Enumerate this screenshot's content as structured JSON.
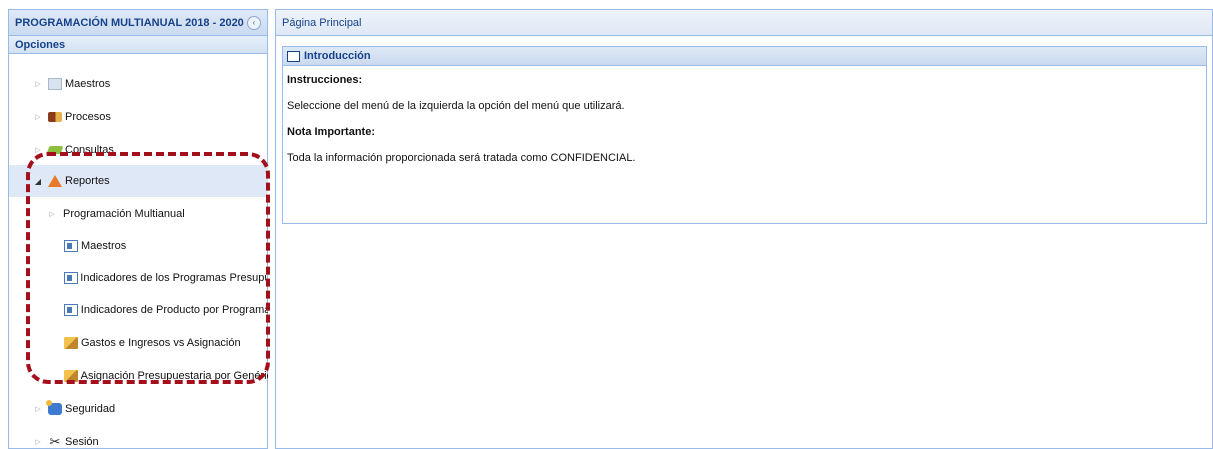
{
  "left_panel": {
    "title": "PROGRAMACIÓN MULTIANUAL 2018 - 2020",
    "collapse_glyph": "‹",
    "options_title": "Opciones"
  },
  "tree": {
    "items": [
      {
        "label": "Maestros",
        "icon": "folder-icon"
      },
      {
        "label": "Procesos",
        "icon": "process-icon"
      },
      {
        "label": "Consultas",
        "icon": "query-icon"
      },
      {
        "label": "Reportes",
        "icon": "reports-icon",
        "expanded": true,
        "selected": true
      },
      {
        "label": "Programación Multianual",
        "icon": ""
      },
      {
        "label": "Maestros",
        "icon": "report-doc-icon"
      },
      {
        "label": "Indicadores de los Programas Presupue",
        "icon": "report-doc-icon"
      },
      {
        "label": "Indicadores de Producto por Programa",
        "icon": "report-doc-icon"
      },
      {
        "label": "Gastos e Ingresos vs Asignación",
        "icon": "report-chart-icon"
      },
      {
        "label": "Asignación Presupuestaria por Genéric",
        "icon": "report-chart-icon"
      },
      {
        "label": "Seguridad",
        "icon": "security-icon"
      },
      {
        "label": "Sesión",
        "icon": "scissors-icon"
      }
    ]
  },
  "right_panel": {
    "title": "Página Principal"
  },
  "intro": {
    "title": "Introducción",
    "instructions_heading": "Instrucciones:",
    "instructions_text": "Seleccione del menú de la izquierda la opción del menú que utilizará.",
    "note_heading": "Nota Importante:",
    "note_text": "Toda la información proporcionada será tratada como CONFIDENCIAL."
  },
  "colors": {
    "panel_border": "#99bbe8",
    "header_text": "#15428b",
    "highlight": "#a3101c",
    "selected_bg": "#dfe8f6"
  }
}
